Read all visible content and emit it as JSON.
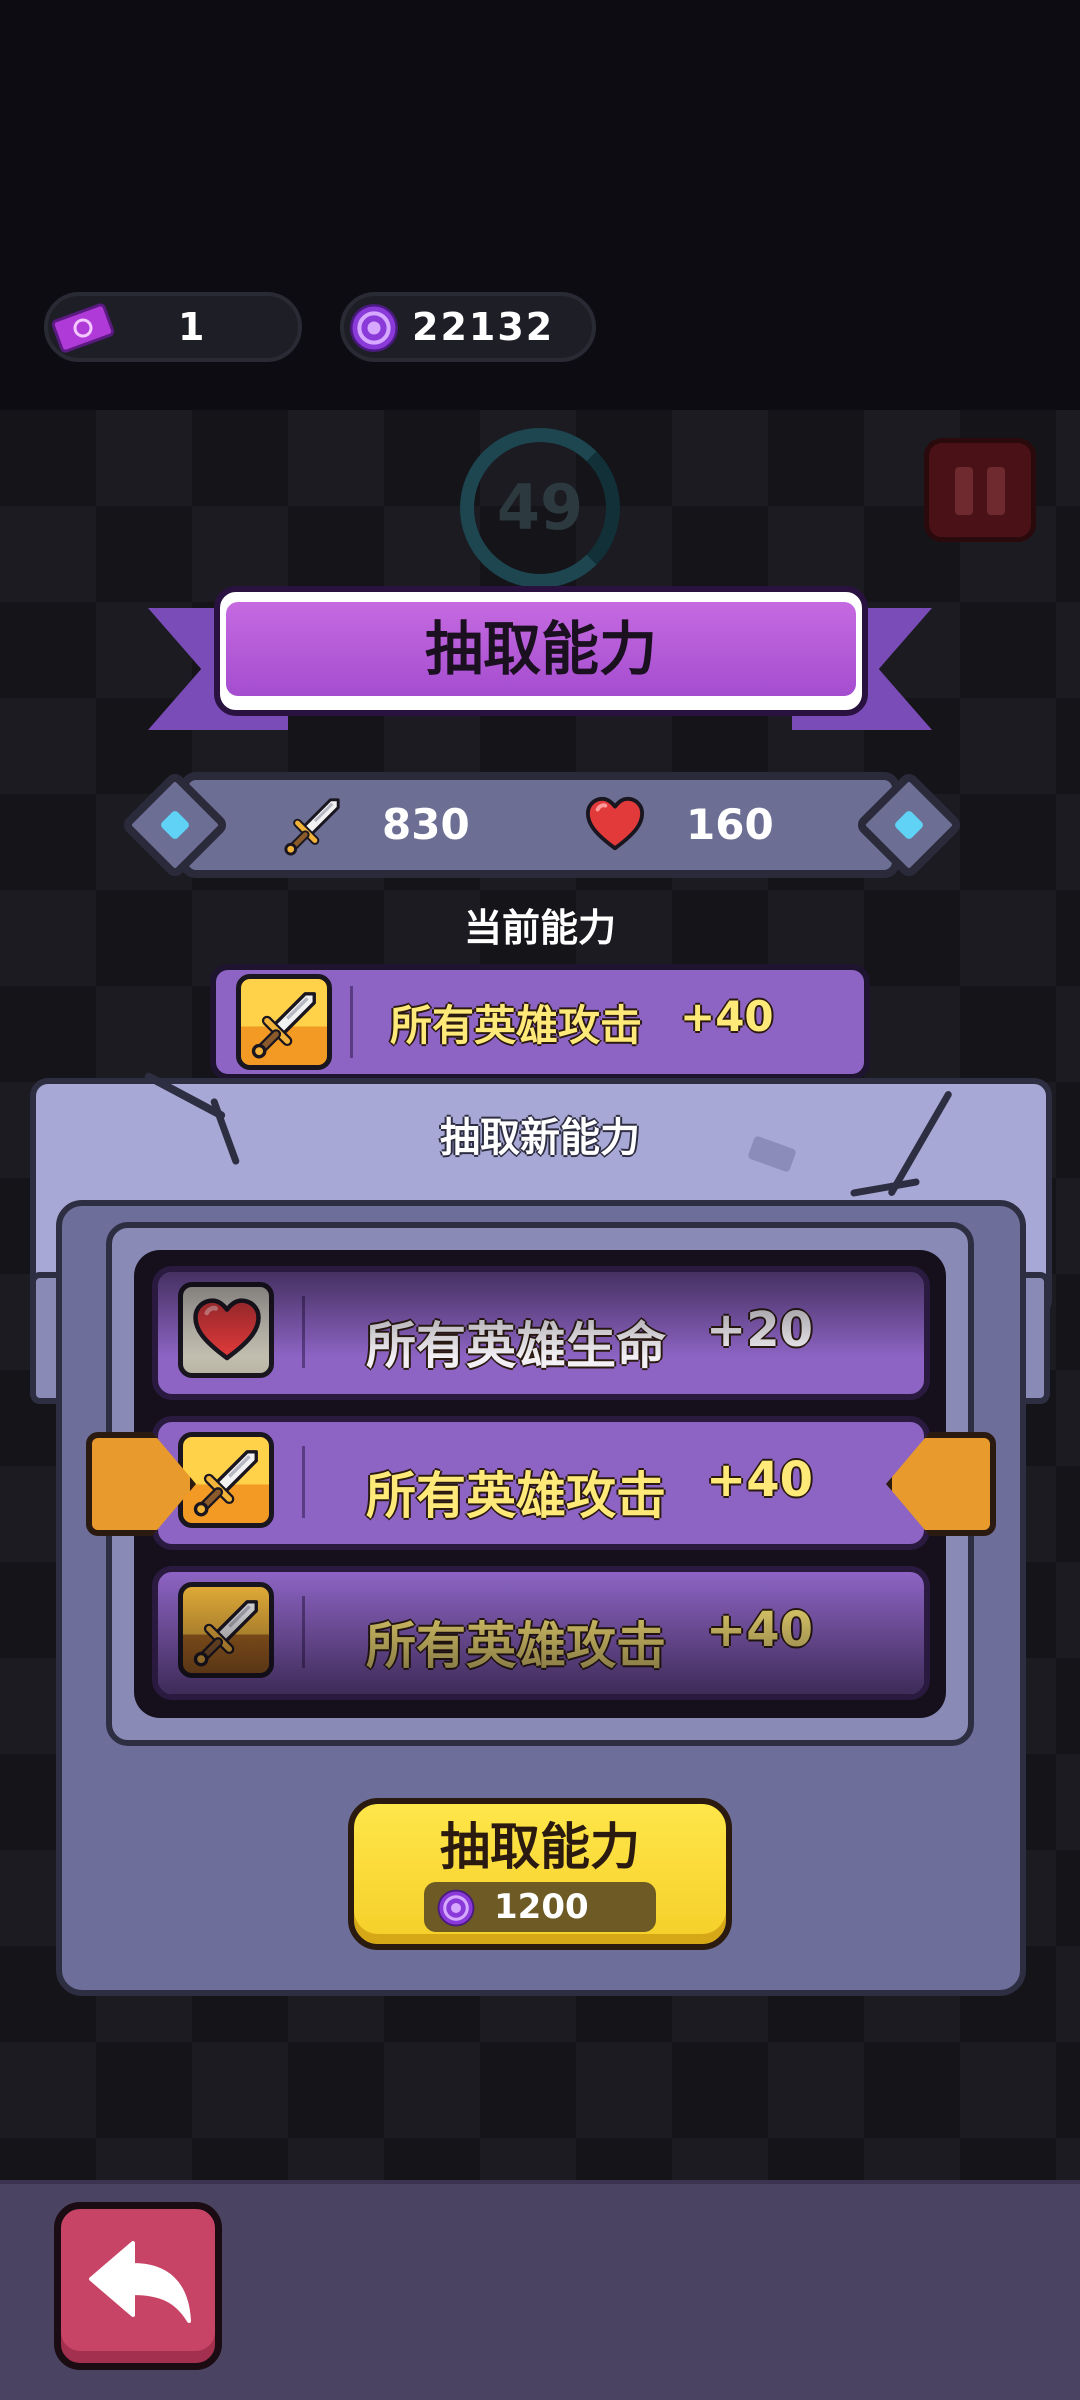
{
  "currency": {
    "tickets": "1",
    "orbs": "22132"
  },
  "timer": {
    "value": "49"
  },
  "title": "抽取能力",
  "stats": {
    "attack": "830",
    "health": "160"
  },
  "current_ability": {
    "label": "当前能力",
    "icon": "sword-icon",
    "name": "所有英雄攻击",
    "value": "+40"
  },
  "draw_panel": {
    "title": "抽取新能力",
    "options": [
      {
        "icon": "heart-icon",
        "name": "所有英雄生命",
        "value": "+20"
      },
      {
        "icon": "sword-icon",
        "name": "所有英雄攻击",
        "value": "+40"
      },
      {
        "icon": "sword-icon",
        "name": "所有英雄攻击",
        "value": "+40"
      }
    ],
    "button_label": "抽取能力",
    "cost": "1200"
  },
  "colors": {
    "ribbon": "#b65ad8",
    "card": "#8d64c4",
    "button": "#ffe03a",
    "back": "#c84466",
    "ability_text": "#ffe978"
  }
}
